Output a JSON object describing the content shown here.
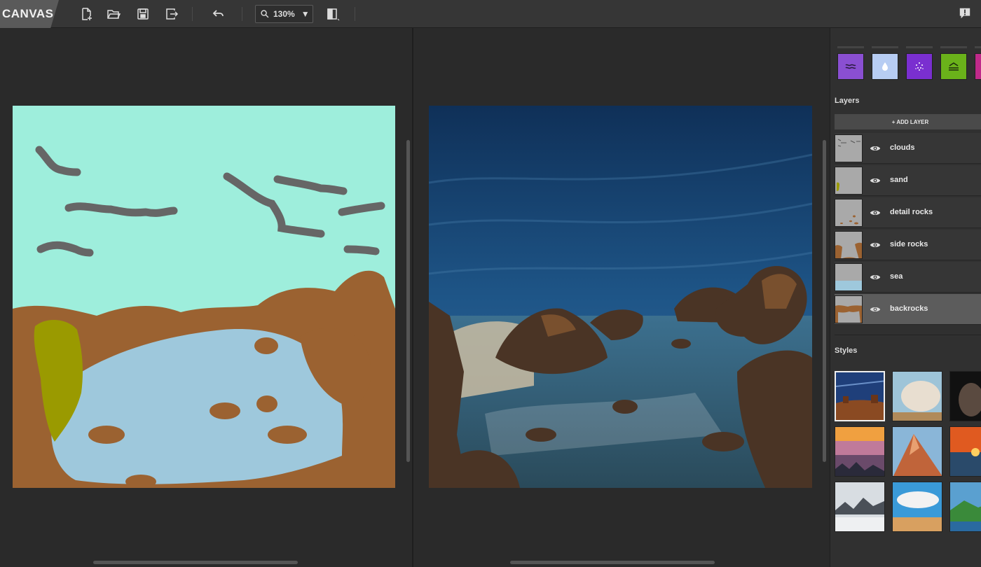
{
  "app": {
    "title": "CANVAS"
  },
  "toolbar": {
    "zoom_value": "130%",
    "icons": [
      "new-file-icon",
      "open-folder-icon",
      "save-icon",
      "export-icon",
      "undo-icon",
      "search-icon",
      "dropdown-caret-icon",
      "split-view-icon",
      "feedback-icon"
    ]
  },
  "materials": [
    {
      "name": "water",
      "color": "#8a4fd2"
    },
    {
      "name": "drop",
      "color": "#b7cdf3"
    },
    {
      "name": "sparkle",
      "color": "#7a2fd0"
    },
    {
      "name": "sea-hut",
      "color": "#6ab21a"
    },
    {
      "name": "magenta",
      "color": "#c02a8a"
    }
  ],
  "layers_panel": {
    "title": "Layers",
    "add_label": "+ ADD LAYER",
    "layers": [
      {
        "name": "clouds",
        "active": false
      },
      {
        "name": "sand",
        "active": false
      },
      {
        "name": "detail rocks",
        "active": false
      },
      {
        "name": "side rocks",
        "active": false
      },
      {
        "name": "sea",
        "active": false
      },
      {
        "name": "backrocks",
        "active": true
      }
    ]
  },
  "styles_panel": {
    "title": "Styles"
  },
  "colors": {
    "sky_label": "#9eeedc",
    "cloud_label": "#666666",
    "rock_label": "#9b6231",
    "water_label": "#9ec8dc",
    "sand_label": "#9a9a00"
  }
}
